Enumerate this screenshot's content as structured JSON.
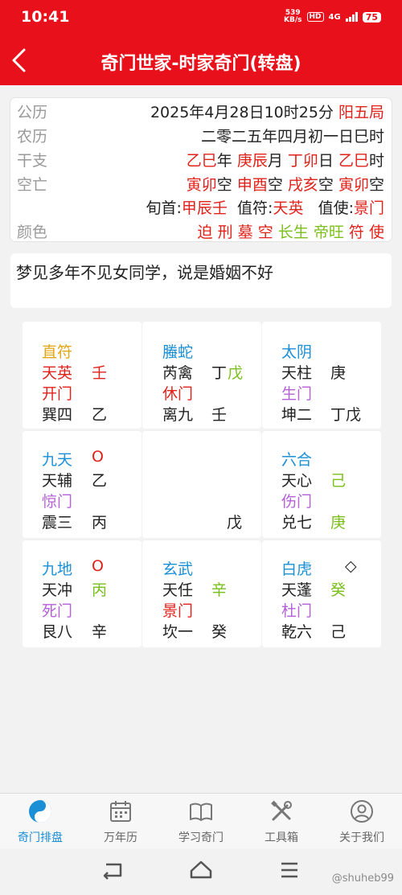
{
  "status": {
    "time": "10:41",
    "net_speed": "539",
    "net_unit": "KB/s",
    "hd": "HD",
    "network": "4G",
    "battery": "75"
  },
  "header": {
    "title": "奇门世家-时家奇门(转盘)"
  },
  "info": {
    "gongli_label": "公历",
    "gongli_date": "2025年4月28日10时25分",
    "gongli_yang": "阳五局",
    "nongli_label": "农历",
    "nongli_value": "二零二五年四月初一日巳时",
    "ganzhi_label": "干支",
    "ganzhi": [
      {
        "gz": "乙巳",
        "unit": "年"
      },
      {
        "gz": "庚辰",
        "unit": "月"
      },
      {
        "gz": "丁卯",
        "unit": "日"
      },
      {
        "gz": "乙巳",
        "unit": "时"
      }
    ],
    "kongwang_label": "空亡",
    "kongwang": [
      {
        "v": "寅卯",
        "unit": "空"
      },
      {
        "v": "申酉",
        "unit": "空"
      },
      {
        "v": "戌亥",
        "unit": "空"
      },
      {
        "v": "寅卯",
        "unit": "空"
      }
    ],
    "xunshou_label": "旬首:",
    "xunshou_value": "甲辰壬",
    "zhifu_label": "值符:",
    "zhifu_value": "天英",
    "zhishi_label": "值使:",
    "zhishi_value": "景门",
    "color_label": "颜色",
    "colors": {
      "po": "迫",
      "xing": "刑",
      "mu": "墓",
      "kong": "空",
      "changsheng": "长生",
      "diwang": "帝旺",
      "fu": "符",
      "shi": "使"
    }
  },
  "question": "梦见多年不见女同学，说是婚姻不好",
  "palaces": {
    "xun": {
      "god": "直符",
      "star": "天英",
      "star_stem": "壬",
      "door": "开门",
      "palace": "巽四",
      "earth_stem": "乙"
    },
    "li": {
      "god": "螣蛇",
      "star": "芮禽",
      "star_stem_a": "丁",
      "star_stem_b": "戊",
      "door": "休门",
      "palace": "离九",
      "earth_stem": "壬"
    },
    "kun": {
      "god": "太阴",
      "star": "天柱",
      "star_stem": "庚",
      "door": "生门",
      "palace": "坤二",
      "earth_stem": "丁戊"
    },
    "zhen": {
      "god": "九天",
      "mark": "O",
      "star": "天辅",
      "star_stem": "乙",
      "door": "惊门",
      "palace": "震三",
      "earth_stem": "丙"
    },
    "center": {
      "earth_stem": "戊"
    },
    "dui": {
      "god": "六合",
      "star": "天心",
      "star_stem": "己",
      "door": "伤门",
      "palace": "兑七",
      "earth_stem": "庚"
    },
    "gen": {
      "god": "九地",
      "mark": "O",
      "star": "天冲",
      "star_stem": "丙",
      "door": "死门",
      "palace": "艮八",
      "earth_stem": "辛"
    },
    "kan": {
      "god": "玄武",
      "star": "天任",
      "star_stem": "辛",
      "door": "景门",
      "palace": "坎一",
      "earth_stem": "癸"
    },
    "qian": {
      "god": "白虎",
      "mark": "◇",
      "star": "天蓬",
      "star_stem": "癸",
      "door": "杜门",
      "palace": "乾六",
      "earth_stem": "己"
    }
  },
  "nav": [
    {
      "label": "奇门排盘",
      "icon": "yin-yang-icon",
      "active": true
    },
    {
      "label": "万年历",
      "icon": "calendar-icon"
    },
    {
      "label": "学习奇门",
      "icon": "book-icon"
    },
    {
      "label": "工具箱",
      "icon": "tools-icon"
    },
    {
      "label": "关于我们",
      "icon": "user-icon"
    }
  ],
  "watermark": "@shuheb99",
  "colors": {
    "brand_red": "#e8111b",
    "gold": "#e0a615",
    "blue": "#1a8fd6",
    "red": "#e0221b",
    "purple": "#b561d9",
    "green": "#7bbf1b"
  }
}
